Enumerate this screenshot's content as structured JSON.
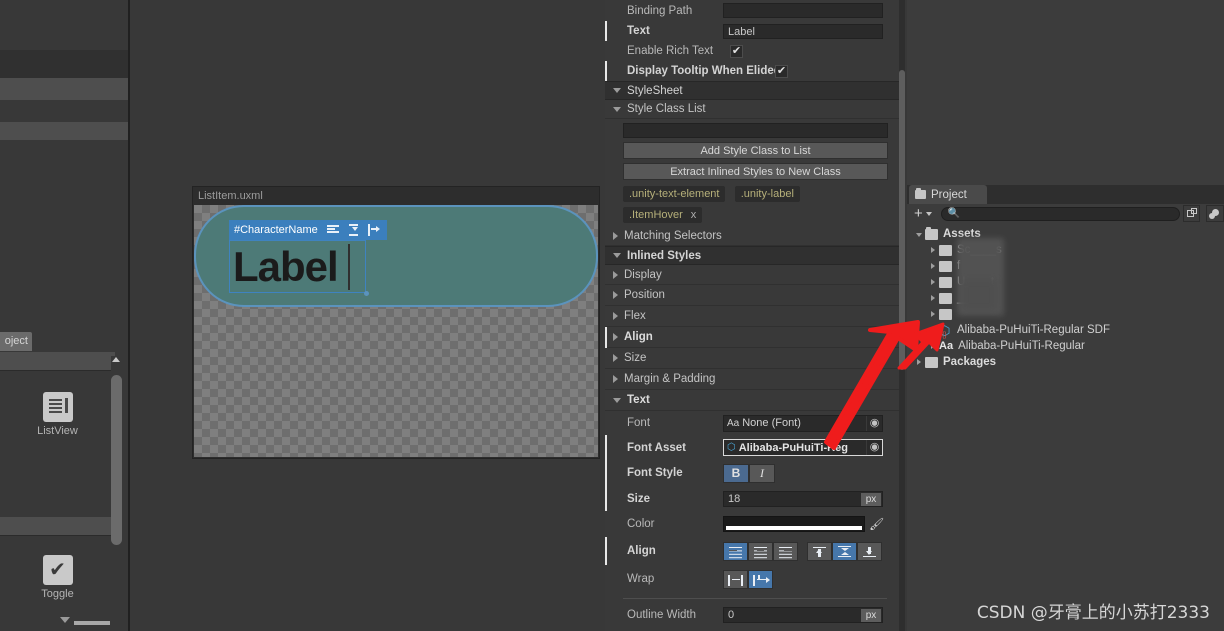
{
  "app": {
    "name": "Unity Editor - UI Builder",
    "watermark": "CSDN @牙膏上的小苏打2333"
  },
  "library_panel": {
    "tab_fragment_label": "oject",
    "items": [
      {
        "label": "ListView",
        "icon": "listview-icon"
      },
      {
        "label": "Toggle",
        "icon": "toggle-icon"
      }
    ]
  },
  "viewport": {
    "document_title": "ListItem.uxml",
    "selection": {
      "badge_name": "#CharacterName",
      "badge_buttons": [
        "text-align-left-icon",
        "vertical-align-center-icon",
        "wrap-nowrap-icon"
      ]
    },
    "label_text": "Label"
  },
  "inspector": {
    "attributes": [
      {
        "label": "Binding Path",
        "type": "textfield",
        "value": "",
        "modified": false
      },
      {
        "label": "Text",
        "type": "textfield",
        "value": "Label",
        "modified": true,
        "bold": true
      },
      {
        "label": "Enable Rich Text",
        "type": "checkbox",
        "checked": true,
        "modified": false
      },
      {
        "label": "Display Tooltip When Elided",
        "type": "checkbox",
        "checked": true,
        "modified": true,
        "bold": true
      }
    ],
    "stylesheet_section": {
      "title": "StyleSheet",
      "style_class_list_title": "Style Class List",
      "class_input_value": "",
      "add_button": "Add Style Class to List",
      "extract_button": "Extract Inlined Styles to New Class",
      "classes": [
        {
          "name": ".unity-text-element",
          "removable": false
        },
        {
          "name": ".unity-label",
          "removable": false
        },
        {
          "name": ".ItemHover",
          "removable": true,
          "remove_label": "x"
        }
      ],
      "matching_selectors": "Matching Selectors"
    },
    "inlined_styles": {
      "title": "Inlined Styles",
      "sections": [
        {
          "label": "Display",
          "expanded": false,
          "bold": false,
          "modified": false
        },
        {
          "label": "Position",
          "expanded": false,
          "bold": false,
          "modified": false
        },
        {
          "label": "Flex",
          "expanded": false,
          "bold": false,
          "modified": false
        },
        {
          "label": "Align",
          "expanded": false,
          "bold": true,
          "modified": true
        },
        {
          "label": "Size",
          "expanded": false,
          "bold": false,
          "modified": false
        },
        {
          "label": "Margin & Padding",
          "expanded": false,
          "bold": false,
          "modified": false
        },
        {
          "label": "Text",
          "expanded": true,
          "bold": true,
          "modified": false
        }
      ]
    },
    "text_section": {
      "font": {
        "label": "Font",
        "value": "None (Font)",
        "glyph": "Aa"
      },
      "font_asset": {
        "label": "Font Asset",
        "value": "Alibaba-PuHuiTi-Reg",
        "glyph": "sdf-icon",
        "modified": true,
        "bold": true
      },
      "font_style": {
        "label": "Font Style",
        "bold_label": "B",
        "italic_label": "I",
        "bold_on": true,
        "italic_on": false,
        "modified": true
      },
      "size": {
        "label": "Size",
        "value": "18",
        "unit": "px",
        "modified": true,
        "bold": true
      },
      "color": {
        "label": "Color",
        "swatch": "#ffffff",
        "eyedropper": "eyedropper-icon"
      },
      "align": {
        "label": "Align",
        "modified": true,
        "horizontal": [
          "align-left-icon",
          "align-center-icon",
          "align-right-icon"
        ],
        "horizontal_selected": 0,
        "vertical": [
          "align-top-icon",
          "align-middle-icon",
          "align-bottom-icon"
        ],
        "vertical_selected": 1
      },
      "wrap": {
        "label": "Wrap",
        "options": [
          "wrap-icon",
          "nowrap-icon"
        ],
        "selected": 1
      },
      "outline_width": {
        "label": "Outline Width",
        "value": "0",
        "unit": "px"
      }
    }
  },
  "project_panel": {
    "tab_label": "Project",
    "add_button": "+",
    "search_placeholder": "",
    "tree": [
      {
        "label": "Assets",
        "depth": 0,
        "icon": "folder-open-icon",
        "expanded": true,
        "bold": true
      },
      {
        "label": "Sc____s",
        "depth": 1,
        "icon": "folder-icon",
        "expanded": false,
        "obscured": true
      },
      {
        "label": "f",
        "depth": 1,
        "icon": "folder-icon",
        "expanded": false,
        "obscured": true
      },
      {
        "label": "U____t",
        "depth": 1,
        "icon": "folder-icon",
        "expanded": false,
        "obscured": true
      },
      {
        "label": "____s",
        "depth": 1,
        "icon": "folder-icon",
        "expanded": false,
        "obscured": true
      },
      {
        "label": "",
        "depth": 1,
        "icon": "folder-icon",
        "expanded": false,
        "obscured": true
      },
      {
        "label": "Alibaba-PuHuiTi-Regular SDF",
        "depth": 1,
        "icon": "font-asset-sdf-icon",
        "expanded": false
      },
      {
        "label": "Alibaba-PuHuiTi-Regular",
        "depth": 1,
        "icon": "font-icon",
        "expanded": false
      },
      {
        "label": "Packages",
        "depth": 0,
        "icon": "folder-icon",
        "expanded": false,
        "bold": true
      }
    ]
  },
  "colors": {
    "accent_blue": "#4677ab",
    "panel_bg": "#383838",
    "header_bg": "#303030",
    "selection_blue": "#3b7fbd",
    "canvas_element": "#4d7a77",
    "class_pill_text": "#b6b07a",
    "arrow_red": "#ef1c1c"
  }
}
